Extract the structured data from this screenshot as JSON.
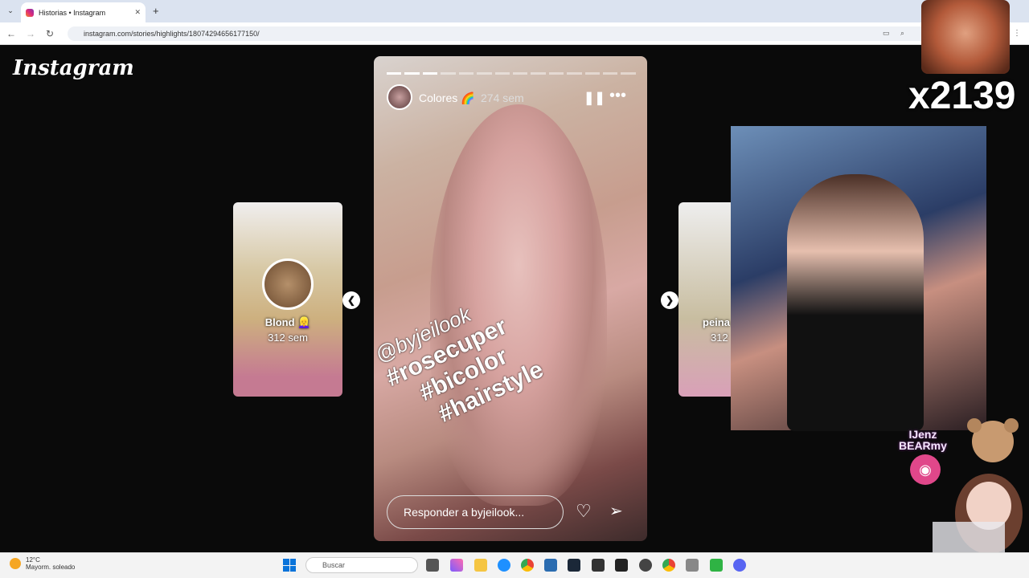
{
  "browser": {
    "tab_title": "Historias • Instagram",
    "new_tab": "+",
    "url": "instagram.com/stories/highlights/18074294656177150/",
    "close_tab": "✕"
  },
  "page": {
    "logo": "Instagram"
  },
  "story": {
    "username": "Colores 🌈",
    "time": "274 sem",
    "sticker_lines": [
      "@byjeilook",
      "#rosecuper",
      "#bicolor",
      "#hairstyle"
    ],
    "reply_placeholder": "Responder a byjeilook...",
    "segments_total": 14,
    "segments_done": 3
  },
  "prev_highlight": {
    "label": "Blond 👱‍♀️",
    "time": "312 sem"
  },
  "next_highlight": {
    "label": "peina",
    "time": "312"
  },
  "overlays": {
    "counter": "x2139",
    "jenz_line1": "IJenz",
    "jenz_line2": "BEARmy"
  },
  "taskbar": {
    "temp": "12°C",
    "weather": "Mayorm. soleado",
    "search": "Buscar"
  }
}
